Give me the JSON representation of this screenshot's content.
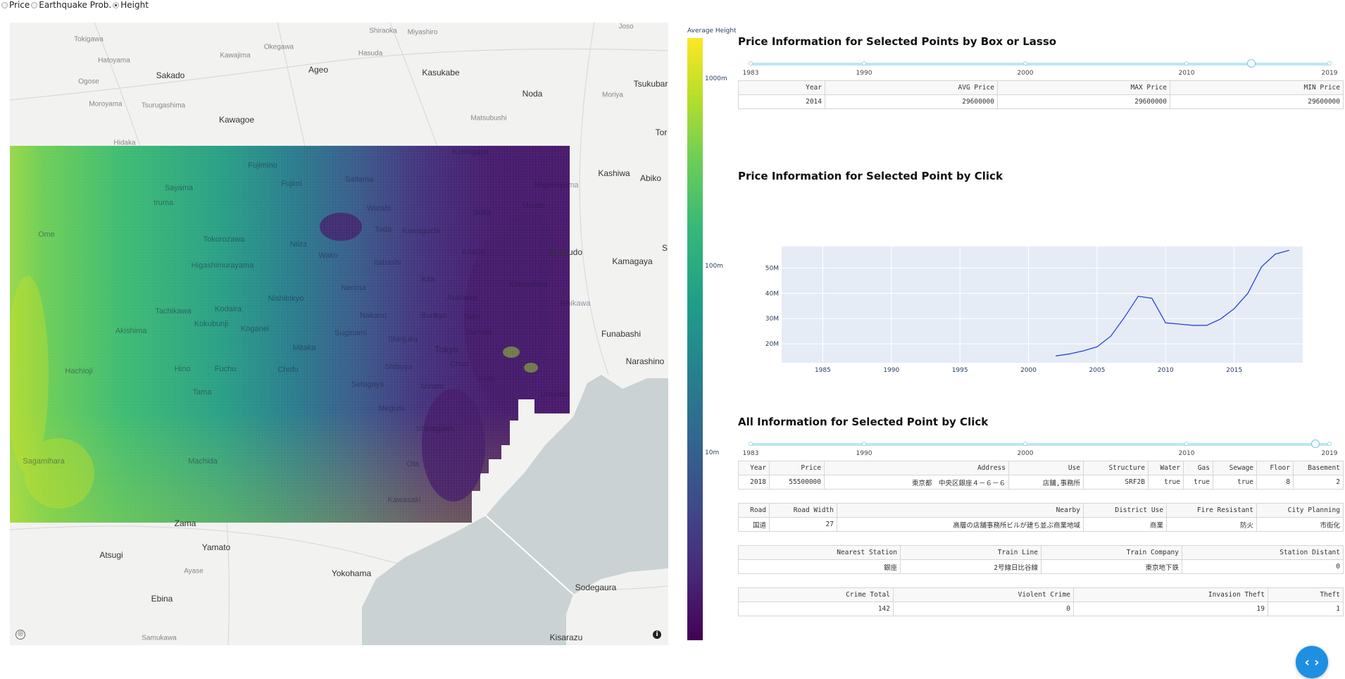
{
  "radio_options": [
    {
      "label": "Price",
      "checked": false
    },
    {
      "label": "Earthquake Prob.",
      "checked": false
    },
    {
      "label": "Height",
      "checked": true
    }
  ],
  "map": {
    "labels": [
      {
        "text": "Tokigawa",
        "kind": "minor"
      },
      {
        "text": "Shiraoka",
        "kind": "minor"
      },
      {
        "text": "Miyashiro",
        "kind": "minor"
      },
      {
        "text": "Joso",
        "kind": "minor"
      },
      {
        "text": "Hatoyama",
        "kind": "minor"
      },
      {
        "text": "Kawajima",
        "kind": "minor"
      },
      {
        "text": "Okegawa",
        "kind": "minor"
      },
      {
        "text": "Hasuda",
        "kind": "minor"
      },
      {
        "text": "Sakado",
        "kind": "major"
      },
      {
        "text": "Ageo",
        "kind": "major"
      },
      {
        "text": "Kasukabe",
        "kind": "major"
      },
      {
        "text": "Tsukubar",
        "kind": "major"
      },
      {
        "text": "Ogose",
        "kind": "minor"
      },
      {
        "text": "Noda",
        "kind": "major"
      },
      {
        "text": "Moroyama",
        "kind": "minor"
      },
      {
        "text": "Tsurugashima",
        "kind": "minor"
      },
      {
        "text": "Moriya",
        "kind": "minor"
      },
      {
        "text": "Kawagoe",
        "kind": "major"
      },
      {
        "text": "Matsubushi",
        "kind": "minor"
      },
      {
        "text": "Tor",
        "kind": "major"
      },
      {
        "text": "Hidaka",
        "kind": "minor"
      },
      {
        "text": "Koshigaya",
        "kind": "onheat"
      },
      {
        "text": "Fujimino",
        "kind": "onheat"
      },
      {
        "text": "Kashiwa",
        "kind": "major"
      },
      {
        "text": "Abiko",
        "kind": "major"
      },
      {
        "text": "Sayama",
        "kind": "onheat"
      },
      {
        "text": "Fujimi",
        "kind": "onheat"
      },
      {
        "text": "Saitama",
        "kind": "onheat"
      },
      {
        "text": "Nagareyama",
        "kind": "onheat"
      },
      {
        "text": "Iruma",
        "kind": "onheat"
      },
      {
        "text": "Warabi",
        "kind": "onheat"
      },
      {
        "text": "Soka",
        "kind": "onheat"
      },
      {
        "text": "Misato",
        "kind": "onheat"
      },
      {
        "text": "Ome",
        "kind": "onheat"
      },
      {
        "text": "Toda",
        "kind": "onheat"
      },
      {
        "text": "Kawaguchi",
        "kind": "onheat"
      },
      {
        "text": "Tokorozawa",
        "kind": "onheat"
      },
      {
        "text": "Niiza",
        "kind": "onheat"
      },
      {
        "text": "Adachi",
        "kind": "onheat"
      },
      {
        "text": "Matsudo",
        "kind": "onheat"
      },
      {
        "text": "Kamagaya",
        "kind": "major"
      },
      {
        "text": "S",
        "kind": "major"
      },
      {
        "text": "Higashimurayama",
        "kind": "onheat"
      },
      {
        "text": "Wako",
        "kind": "onheat"
      },
      {
        "text": "Itabashi",
        "kind": "onheat"
      },
      {
        "text": "Kita",
        "kind": "onheat"
      },
      {
        "text": "Katsushika",
        "kind": "onheat"
      },
      {
        "text": "Nerima",
        "kind": "onheat"
      },
      {
        "text": "Nishitokyo",
        "kind": "onheat"
      },
      {
        "text": "Arakawa",
        "kind": "onheat"
      },
      {
        "text": "Ichikawa",
        "kind": "onheat"
      },
      {
        "text": "Tachikawa",
        "kind": "onheat"
      },
      {
        "text": "Kodaira",
        "kind": "onheat"
      },
      {
        "text": "Nakano",
        "kind": "onheat"
      },
      {
        "text": "Bunkyo",
        "kind": "onheat"
      },
      {
        "text": "Taito",
        "kind": "onheat"
      },
      {
        "text": "Akishima",
        "kind": "onheat"
      },
      {
        "text": "Kokubunji",
        "kind": "onheat"
      },
      {
        "text": "Koganei",
        "kind": "onheat"
      },
      {
        "text": "Suginami",
        "kind": "onheat"
      },
      {
        "text": "Sumida",
        "kind": "onheat"
      },
      {
        "text": "Funabashi",
        "kind": "major"
      },
      {
        "text": "Shinjuku",
        "kind": "onheat"
      },
      {
        "text": "Mitaka",
        "kind": "onheat"
      },
      {
        "text": "Tokyo",
        "kind": "big"
      },
      {
        "text": "Narashino",
        "kind": "major"
      },
      {
        "text": "Hachioji",
        "kind": "onheat"
      },
      {
        "text": "Chuo",
        "kind": "onheat"
      },
      {
        "text": "Hino",
        "kind": "onheat"
      },
      {
        "text": "Fuchu",
        "kind": "onheat"
      },
      {
        "text": "Chofu",
        "kind": "onheat"
      },
      {
        "text": "Shibuya",
        "kind": "onheat"
      },
      {
        "text": "Koto",
        "kind": "onheat"
      },
      {
        "text": "Setagaya",
        "kind": "onheat"
      },
      {
        "text": "Minato",
        "kind": "onheat"
      },
      {
        "text": "Tama",
        "kind": "onheat"
      },
      {
        "text": "Urayasu",
        "kind": "onheat"
      },
      {
        "text": "Meguro",
        "kind": "onheat"
      },
      {
        "text": "Shinagawa",
        "kind": "onheat"
      },
      {
        "text": "Sagamihara",
        "kind": "onheat"
      },
      {
        "text": "Machida",
        "kind": "onheat"
      },
      {
        "text": "Ota",
        "kind": "onheat"
      },
      {
        "text": "Kawasaki",
        "kind": "onheat"
      },
      {
        "text": "Zama",
        "kind": "major"
      },
      {
        "text": "Yamato",
        "kind": "major"
      },
      {
        "text": "Atsugi",
        "kind": "major"
      },
      {
        "text": "Ayase",
        "kind": "minor"
      },
      {
        "text": "Yokohama",
        "kind": "major"
      },
      {
        "text": "Sodegaura",
        "kind": "major"
      },
      {
        "text": "Ebina",
        "kind": "major"
      },
      {
        "text": "Samukawa",
        "kind": "minor"
      },
      {
        "text": "Kisarazu",
        "kind": "major"
      }
    ]
  },
  "colorbar": {
    "title": "Average Height",
    "ticks": [
      "1000m",
      "100m",
      "10m"
    ],
    "colors": [
      "#fde725",
      "#35b779",
      "#26828e",
      "#3e4989",
      "#440154"
    ]
  },
  "section1": {
    "title": "Price Information for Selected Points by Box or Lasso",
    "slider_labels": [
      "1983",
      "1990",
      "2000",
      "2010",
      "2019"
    ],
    "slider_value": "2014",
    "table": {
      "headers": [
        "Year",
        "AVG Price",
        "MAX Price",
        "MIN Price"
      ],
      "row": [
        "2014",
        "29600000",
        "29600000",
        "29600000"
      ]
    }
  },
  "section2": {
    "title": "Price Information for Selected Point by Click"
  },
  "section3": {
    "title": "All Information for Selected Point by Click",
    "slider_labels": [
      "1983",
      "1990",
      "2000",
      "2010",
      "2019"
    ],
    "slider_value": "2018",
    "table1": {
      "headers": [
        "Year",
        "Price",
        "Address",
        "Use",
        "Structure",
        "Water",
        "Gas",
        "Sewage",
        "Floor",
        "Basement"
      ],
      "row": [
        "2018",
        "55500000",
        "東京都　中央区銀座４－６－６",
        "店舗,事務所",
        "SRF2B",
        "true",
        "true",
        "true",
        "8",
        "2"
      ]
    },
    "table2": {
      "headers": [
        "Road",
        "Road Width",
        "Nearby",
        "District Use",
        "Fire Resistant",
        "City Planning"
      ],
      "row": [
        "国道",
        "27",
        "高層の店舗事務所ビルが建ち並ぶ商業地域",
        "商業",
        "防火",
        "市街化"
      ]
    },
    "table3": {
      "headers": [
        "Nearest Station",
        "Train Line",
        "Train Company",
        "Station Distant"
      ],
      "row": [
        "銀座",
        "2号線日比谷線",
        "東京地下鉄",
        "0"
      ]
    },
    "table4": {
      "headers": [
        "Crime Total",
        "Violent Crime",
        "Invasion Theft",
        "Theft"
      ],
      "row": [
        "142",
        "0",
        "19",
        "1"
      ]
    }
  },
  "chart_data": {
    "type": "line",
    "title": "",
    "xlabel": "",
    "ylabel": "",
    "x_ticks": [
      "1985",
      "1990",
      "1995",
      "2000",
      "2005",
      "2010",
      "2015"
    ],
    "y_ticks": [
      "20M",
      "30M",
      "40M",
      "50M"
    ],
    "xlim": [
      1982,
      2020
    ],
    "ylim": [
      12500000,
      58500000
    ],
    "grid": true,
    "line_color": "#2b45d4",
    "background": "#e5ecf6",
    "series": [
      {
        "x": [
          2002,
          2003,
          2004,
          2005,
          2006,
          2007,
          2008,
          2009,
          2010,
          2011,
          2012,
          2013,
          2014,
          2015,
          2016,
          2017,
          2018,
          2019
        ],
        "y": [
          15200000,
          16000000,
          17200000,
          18800000,
          23000000,
          30500000,
          38800000,
          38000000,
          28300000,
          27800000,
          27300000,
          27300000,
          29800000,
          33900000,
          40000000,
          50500000,
          55500000,
          57000000
        ]
      }
    ]
  },
  "fab": {
    "label": "‹ ›"
  }
}
